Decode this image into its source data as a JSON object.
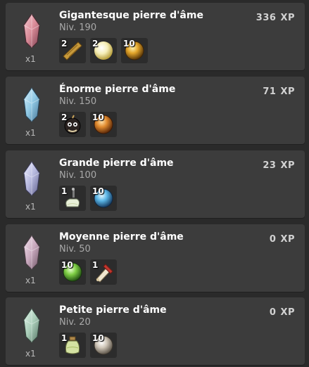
{
  "colors": {
    "background": "#2a2a2a",
    "card": "#3c3c3c",
    "xp_text": "#d2d2d2"
  },
  "recipes": [
    {
      "name": "Gigantesque pierre d'âme",
      "level": "Niv. 190",
      "xp_value": "336",
      "xp_unit": "XP",
      "quantity": "x1",
      "gem_icon": "gigantic-soul-stone-icon",
      "ingredients": [
        {
          "count": "2",
          "icon": "wooden-plank-icon"
        },
        {
          "count": "2",
          "icon": "pale-orb-icon"
        },
        {
          "count": "10",
          "icon": "golden-orb-icon"
        }
      ]
    },
    {
      "name": "Énorme pierre d'âme",
      "level": "Niv. 150",
      "xp_value": "71",
      "xp_unit": "XP",
      "quantity": "x1",
      "gem_icon": "huge-soul-stone-icon",
      "ingredients": [
        {
          "count": "2",
          "icon": "bomb-creature-icon"
        },
        {
          "count": "10",
          "icon": "amber-orb-icon"
        }
      ]
    },
    {
      "name": "Grande pierre d'âme",
      "level": "Niv. 100",
      "xp_value": "23",
      "xp_unit": "XP",
      "quantity": "x1",
      "gem_icon": "large-soul-stone-icon",
      "ingredients": [
        {
          "count": "1",
          "icon": "potion-flask-icon"
        },
        {
          "count": "10",
          "icon": "blue-orb-icon"
        }
      ]
    },
    {
      "name": "Moyenne pierre d'âme",
      "level": "Niv. 50",
      "xp_value": "0",
      "xp_unit": "XP",
      "quantity": "x1",
      "gem_icon": "medium-soul-stone-icon",
      "ingredients": [
        {
          "count": "10",
          "icon": "green-orb-icon"
        },
        {
          "count": "1",
          "icon": "scroll-icon"
        }
      ]
    },
    {
      "name": "Petite pierre d'âme",
      "level": "Niv. 20",
      "xp_value": "0",
      "xp_unit": "XP",
      "quantity": "x1",
      "gem_icon": "small-soul-stone-icon",
      "ingredients": [
        {
          "count": "1",
          "icon": "elixir-jar-icon"
        },
        {
          "count": "10",
          "icon": "grey-orb-icon"
        }
      ]
    }
  ]
}
